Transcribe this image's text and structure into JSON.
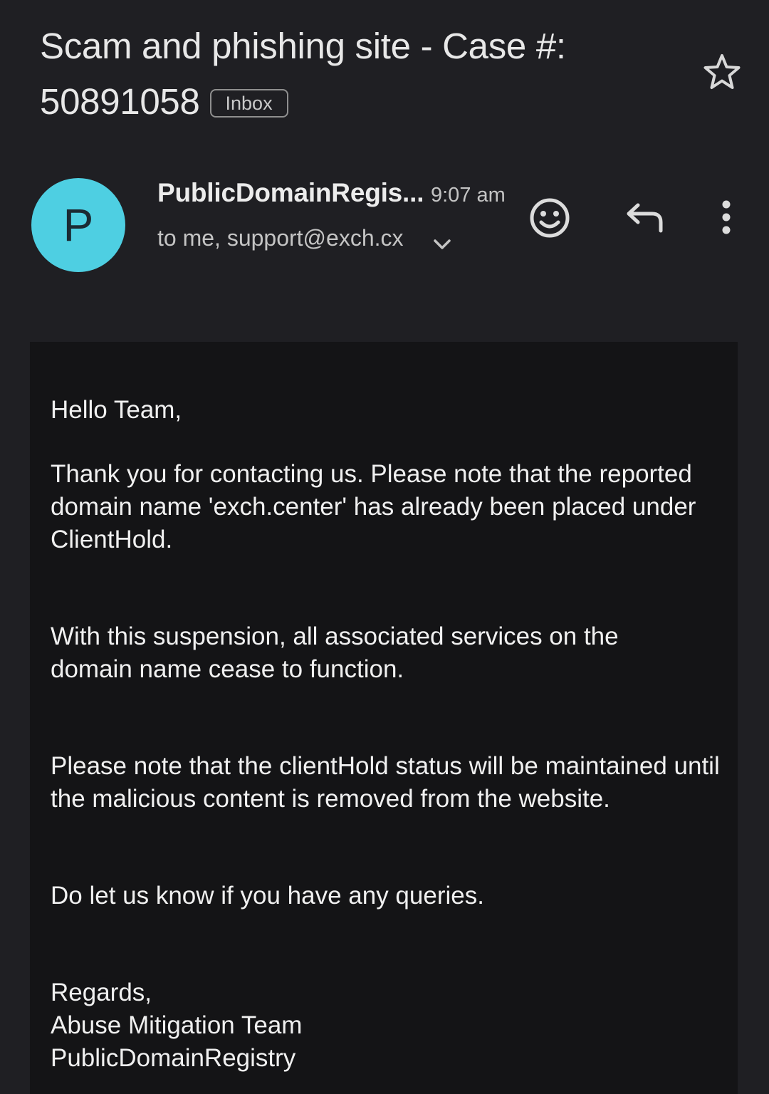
{
  "email": {
    "subject_line1": "Scam and phishing site - Case #:",
    "subject_line2": "50891058",
    "label": "Inbox",
    "sender_initial": "P",
    "sender_name": "PublicDomainRegis...",
    "time": "9:07 am",
    "recipients": "to me, support@exch.cx"
  },
  "icons": {
    "star": "star-outline-icon",
    "chevron": "chevron-down-icon",
    "emoji": "add-reaction-icon",
    "reply": "reply-icon",
    "more": "more-vert-icon"
  },
  "body": {
    "greeting": "Hello Team,",
    "para1": "Thank you for contacting us. Please note that the reported domain name 'exch.center' has already been placed under ClientHold.",
    "para2": "With this suspension, all associated services on the domain name cease to function.",
    "para3": "Please note that the clientHold status will be maintained until the malicious content is removed from the website.",
    "para4": "Do let us know if you have any queries.",
    "signoff": "Regards,",
    "sig_team": "Abuse Mitigation Team",
    "sig_org": "PublicDomainRegistry"
  },
  "colors": {
    "background": "#1f1f23",
    "card": "#141416",
    "avatar": "#4ecfe2"
  }
}
